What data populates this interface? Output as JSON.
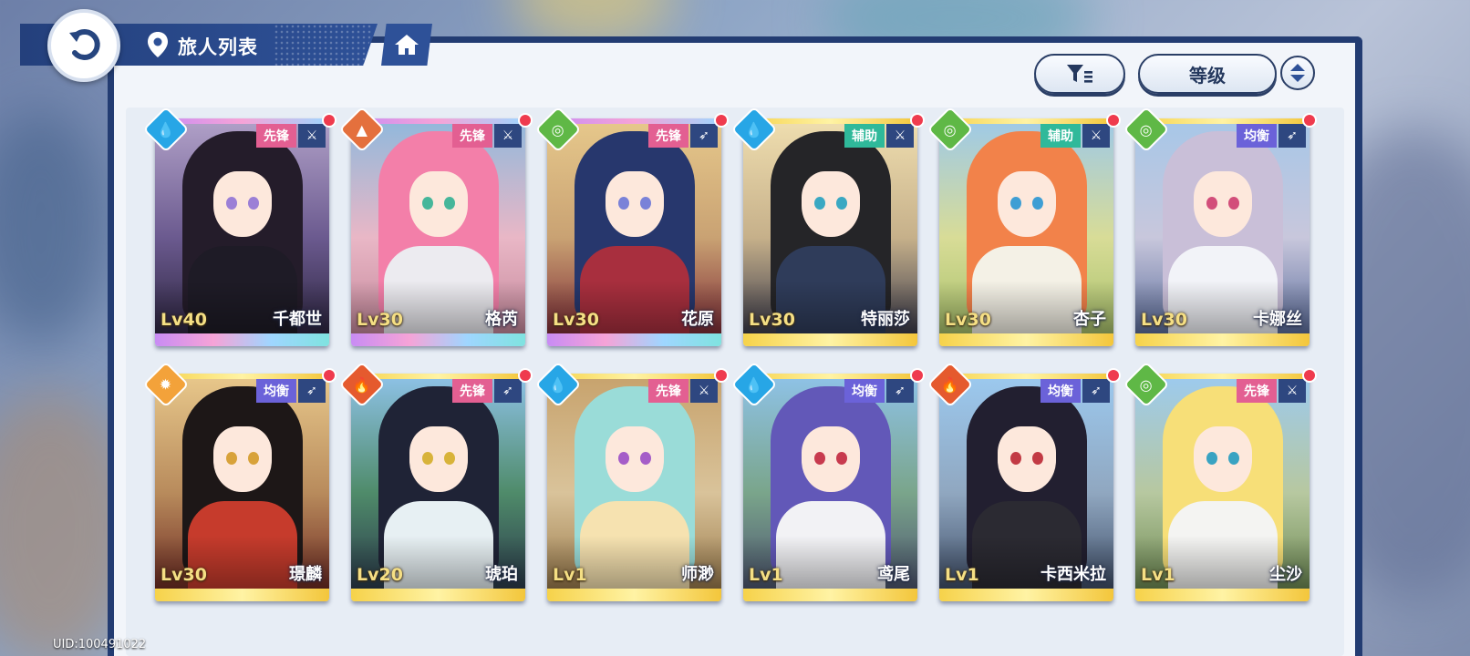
{
  "header": {
    "title": "旅人列表",
    "back_icon": "back-arrow-icon",
    "location_icon": "location-pin-icon",
    "home_icon": "home-icon"
  },
  "controls": {
    "filter_icon": "filter-icon",
    "sort_label": "等级",
    "order_icon": "sort-order-icon"
  },
  "characters": [
    {
      "name": "千都世",
      "level": "Lv40",
      "role": "先锋",
      "element": "water",
      "weapon": "sword",
      "rarity": "rainbow"
    },
    {
      "name": "格芮",
      "level": "Lv30",
      "role": "先锋",
      "element": "earth",
      "weapon": "sword",
      "rarity": "rainbow"
    },
    {
      "name": "花原",
      "level": "Lv30",
      "role": "先锋",
      "element": "wind",
      "weapon": "bow",
      "rarity": "rainbow"
    },
    {
      "name": "特丽莎",
      "level": "Lv30",
      "role": "辅助",
      "element": "water",
      "weapon": "sword",
      "rarity": "gold"
    },
    {
      "name": "杏子",
      "level": "Lv30",
      "role": "辅助",
      "element": "wind",
      "weapon": "sword",
      "rarity": "gold"
    },
    {
      "name": "卡娜丝",
      "level": "Lv30",
      "role": "均衡",
      "element": "wind",
      "weapon": "bow",
      "rarity": "gold"
    },
    {
      "name": "璟麟",
      "level": "Lv30",
      "role": "均衡",
      "element": "light",
      "weapon": "bow",
      "rarity": "gold"
    },
    {
      "name": "琥珀",
      "level": "Lv20",
      "role": "先锋",
      "element": "fire",
      "weapon": "bow",
      "rarity": "gold"
    },
    {
      "name": "师渺",
      "level": "Lv1",
      "role": "先锋",
      "element": "water",
      "weapon": "sword",
      "rarity": "gold"
    },
    {
      "name": "鸢尾",
      "level": "Lv1",
      "role": "均衡",
      "element": "water",
      "weapon": "bow",
      "rarity": "gold"
    },
    {
      "name": "卡西米拉",
      "level": "Lv1",
      "role": "均衡",
      "element": "fire",
      "weapon": "bow",
      "rarity": "gold"
    },
    {
      "name": "尘沙",
      "level": "Lv1",
      "role": "先锋",
      "element": "wind",
      "weapon": "sword",
      "rarity": "gold"
    }
  ],
  "uid": "UID:100491022",
  "colors": {
    "header_blue": "#2e5198",
    "panel_border": "#233c72",
    "badge_dot": "#ef3b4e",
    "role_vanguard": "#e35f92",
    "role_support": "#2fb99a",
    "role_balanced": "#6b62d9",
    "element_water": "#27a6e6",
    "element_earth": "#e4703d",
    "element_wind": "#5fb846",
    "element_fire": "#e55a2e",
    "element_light": "#f3a23a"
  }
}
